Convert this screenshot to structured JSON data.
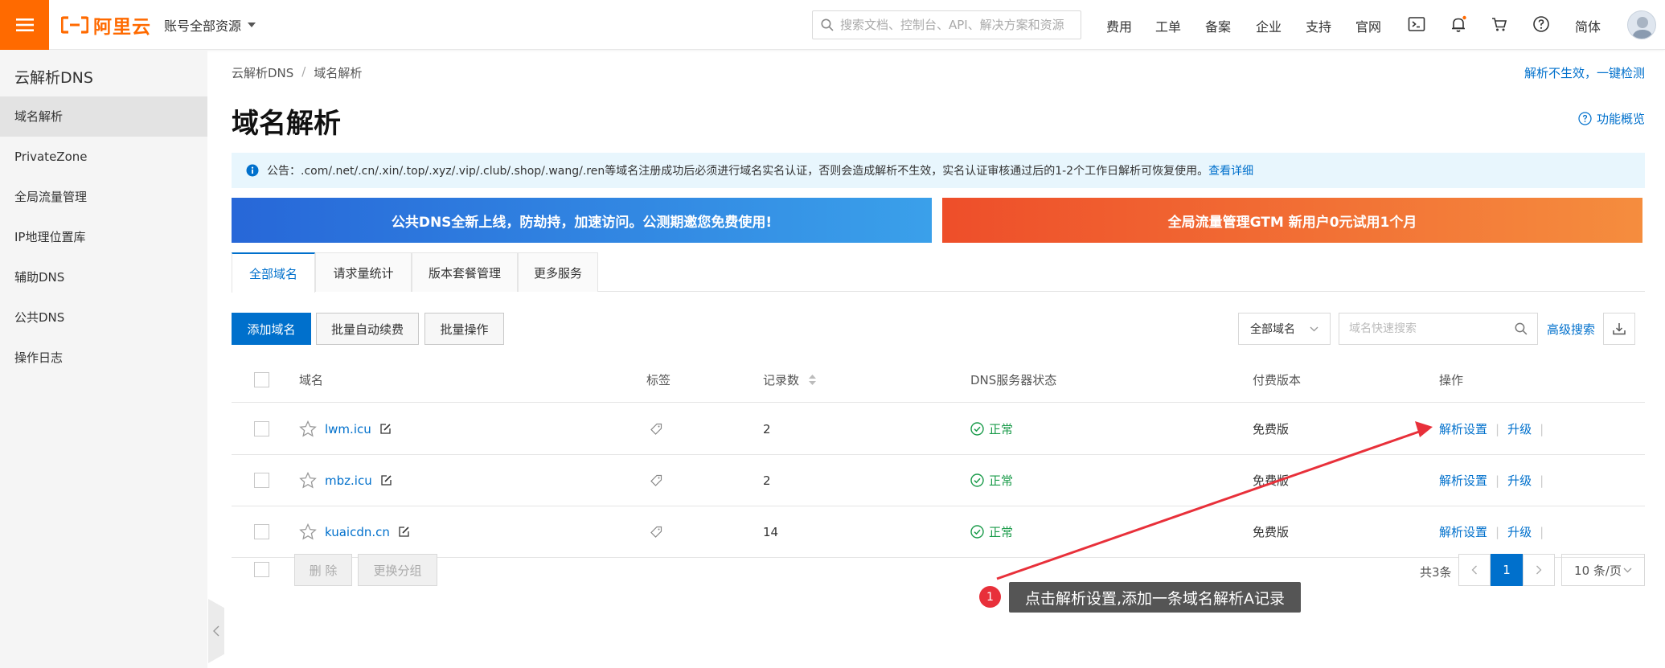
{
  "topbar": {
    "logo_text": "阿里云",
    "account_label": "账号全部资源",
    "search_placeholder": "搜索文档、控制台、API、解决方案和资源",
    "nav": [
      "费用",
      "工单",
      "备案",
      "企业",
      "支持",
      "官网"
    ],
    "lang": "简体"
  },
  "sidebar": {
    "title": "云解析DNS",
    "items": [
      {
        "label": "域名解析",
        "active": true
      },
      {
        "label": "PrivateZone",
        "active": false
      },
      {
        "label": "全局流量管理",
        "active": false
      },
      {
        "label": "IP地理位置库",
        "active": false
      },
      {
        "label": "辅助DNS",
        "active": false
      },
      {
        "label": "公共DNS",
        "active": false
      },
      {
        "label": "操作日志",
        "active": false
      }
    ]
  },
  "breadcrumb": [
    "云解析DNS",
    "/",
    "域名解析"
  ],
  "header": {
    "check_link": "解析不生效，一键检测",
    "title": "域名解析",
    "overview": "功能概览"
  },
  "notice": {
    "text": "公告：.com/.net/.cn/.xin/.top/.xyz/.vip/.club/.shop/.wang/.ren等域名注册成功后必须进行域名实名认证，否则会造成解析不生效，实名认证审核通过后的1-2个工作日解析可恢复使用。",
    "link": "查看详细"
  },
  "banners": {
    "dns": "公共DNS全新上线，防劫持，加速访问。公测期邀您免费使用!",
    "gtm": "全局流量管理GTM 新用户0元试用1个月"
  },
  "tabs": [
    "全部域名",
    "请求量统计",
    "版本套餐管理",
    "更多服务"
  ],
  "toolbar": {
    "add": "添加域名",
    "renew": "批量自动续费",
    "batch": "批量操作",
    "scope": "全部域名",
    "search_placeholder": "域名快速搜索",
    "advanced": "高级搜索"
  },
  "table": {
    "headers": {
      "domain": "域名",
      "tag": "标签",
      "records": "记录数",
      "dns_status": "DNS服务器状态",
      "edition": "付费版本",
      "ops": "操作"
    },
    "rows": [
      {
        "domain": "lwm.icu",
        "records": "2",
        "status": "正常",
        "edition": "免费版",
        "op1": "解析设置",
        "op2": "升级"
      },
      {
        "domain": "mbz.icu",
        "records": "2",
        "status": "正常",
        "edition": "免费版",
        "op1": "解析设置",
        "op2": "升级"
      },
      {
        "domain": "kuaicdn.cn",
        "records": "14",
        "status": "正常",
        "edition": "免费版",
        "op1": "解析设置",
        "op2": "升级"
      }
    ]
  },
  "footer": {
    "delete": "删 除",
    "regroup": "更换分组",
    "total": "共3条",
    "page": "1",
    "page_size": "10 条/页"
  },
  "annotation": {
    "number": "1",
    "text": "点击解析设置,添加一条域名解析A记录"
  },
  "colors": {
    "brand": "#ff6a00",
    "link": "#0070cc",
    "success": "#1a9b4a",
    "annotation": "#e8303a"
  }
}
